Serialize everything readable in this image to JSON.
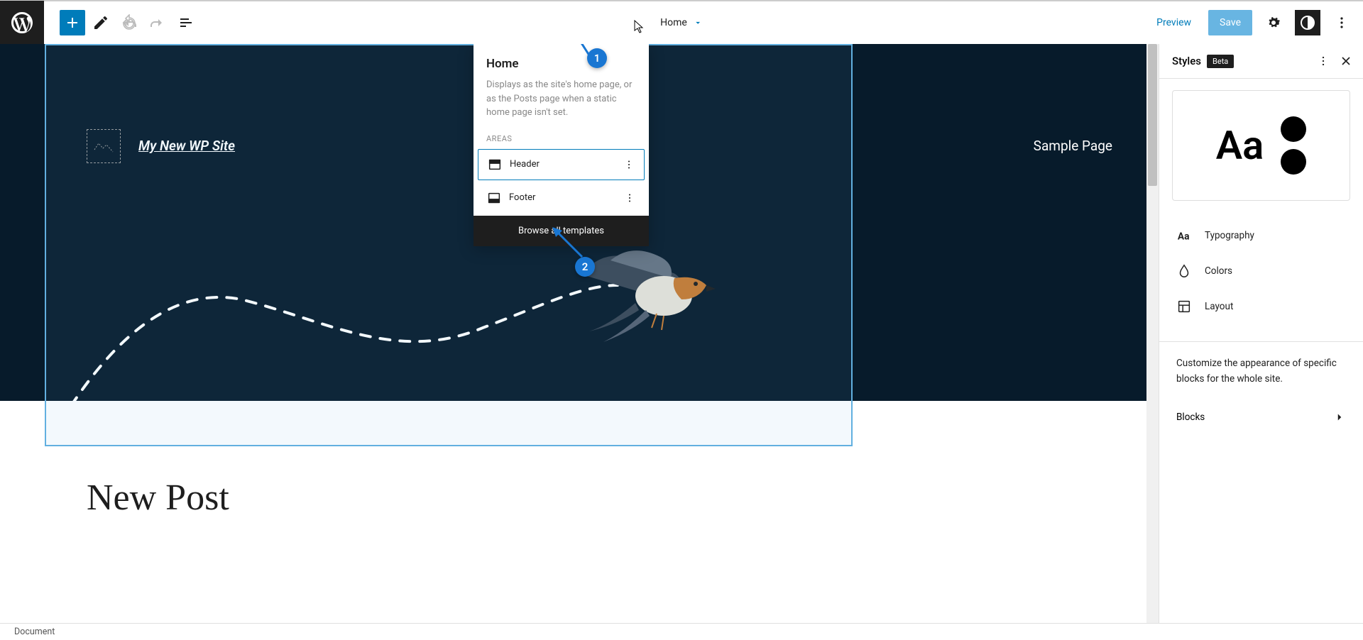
{
  "toolbar": {
    "template_name": "Home",
    "preview": "Preview",
    "save": "Save"
  },
  "dropdown": {
    "title": "Home",
    "description": "Displays as the site's home page, or as the Posts page when a static home page isn't set.",
    "areas_label": "AREAS",
    "areas": [
      {
        "label": "Header"
      },
      {
        "label": "Footer"
      }
    ],
    "browse": "Browse all templates"
  },
  "callouts": {
    "one": "1",
    "two": "2"
  },
  "hero": {
    "site_title": "My New WP Site",
    "nav_item": "Sample Page"
  },
  "content": {
    "post_title": "New Post"
  },
  "sidebar": {
    "title": "Styles",
    "beta": "Beta",
    "preview_text": "Aa",
    "items": [
      {
        "label": "Typography"
      },
      {
        "label": "Colors"
      },
      {
        "label": "Layout"
      }
    ],
    "note": "Customize the appearance of specific blocks for the whole site.",
    "blocks": "Blocks"
  },
  "footer": {
    "breadcrumb": "Document"
  }
}
